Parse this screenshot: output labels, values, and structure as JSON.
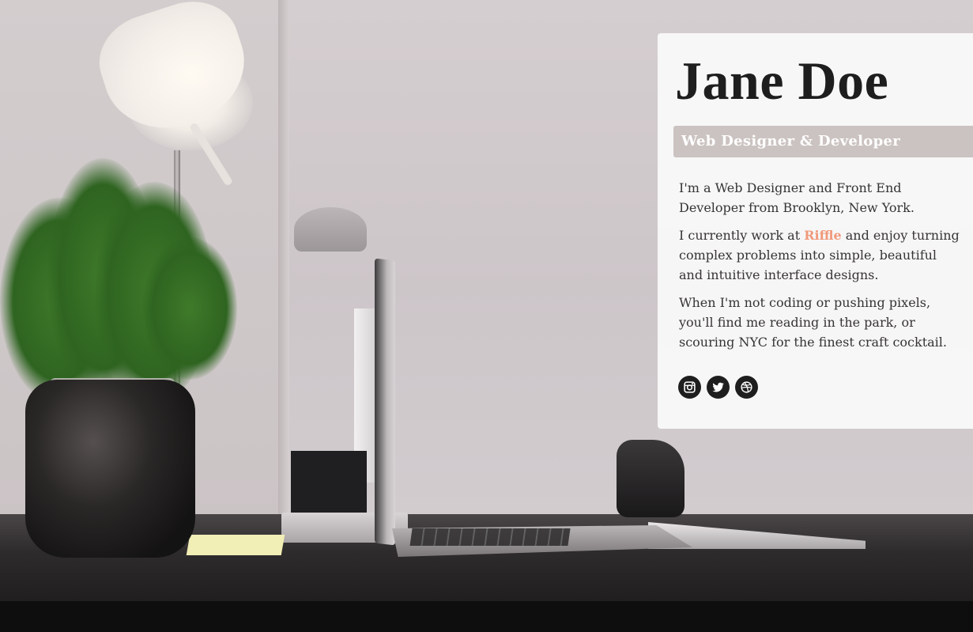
{
  "profile": {
    "name": "Jane Doe",
    "title": "Web Designer & Developer"
  },
  "bio": {
    "p1": "I'm a Web Designer and Front End Developer from Brooklyn, New York.",
    "p2_before": "I currently work at ",
    "p2_link": "Riffle",
    "p2_after": " and enjoy turning complex problems into simple, beautiful and intuitive interface designs.",
    "p3": "When I'm not coding or pushing pixels, you'll find me reading in the park, or scouring NYC for the finest craft cocktail."
  },
  "social": [
    {
      "icon": "instagram-icon"
    },
    {
      "icon": "twitter-icon"
    },
    {
      "icon": "dribbble-icon"
    }
  ],
  "colors": {
    "accent_link": "#f0997a",
    "title_band": "#cbc3c1",
    "text": "#363434",
    "heading": "#1f1e1e"
  }
}
